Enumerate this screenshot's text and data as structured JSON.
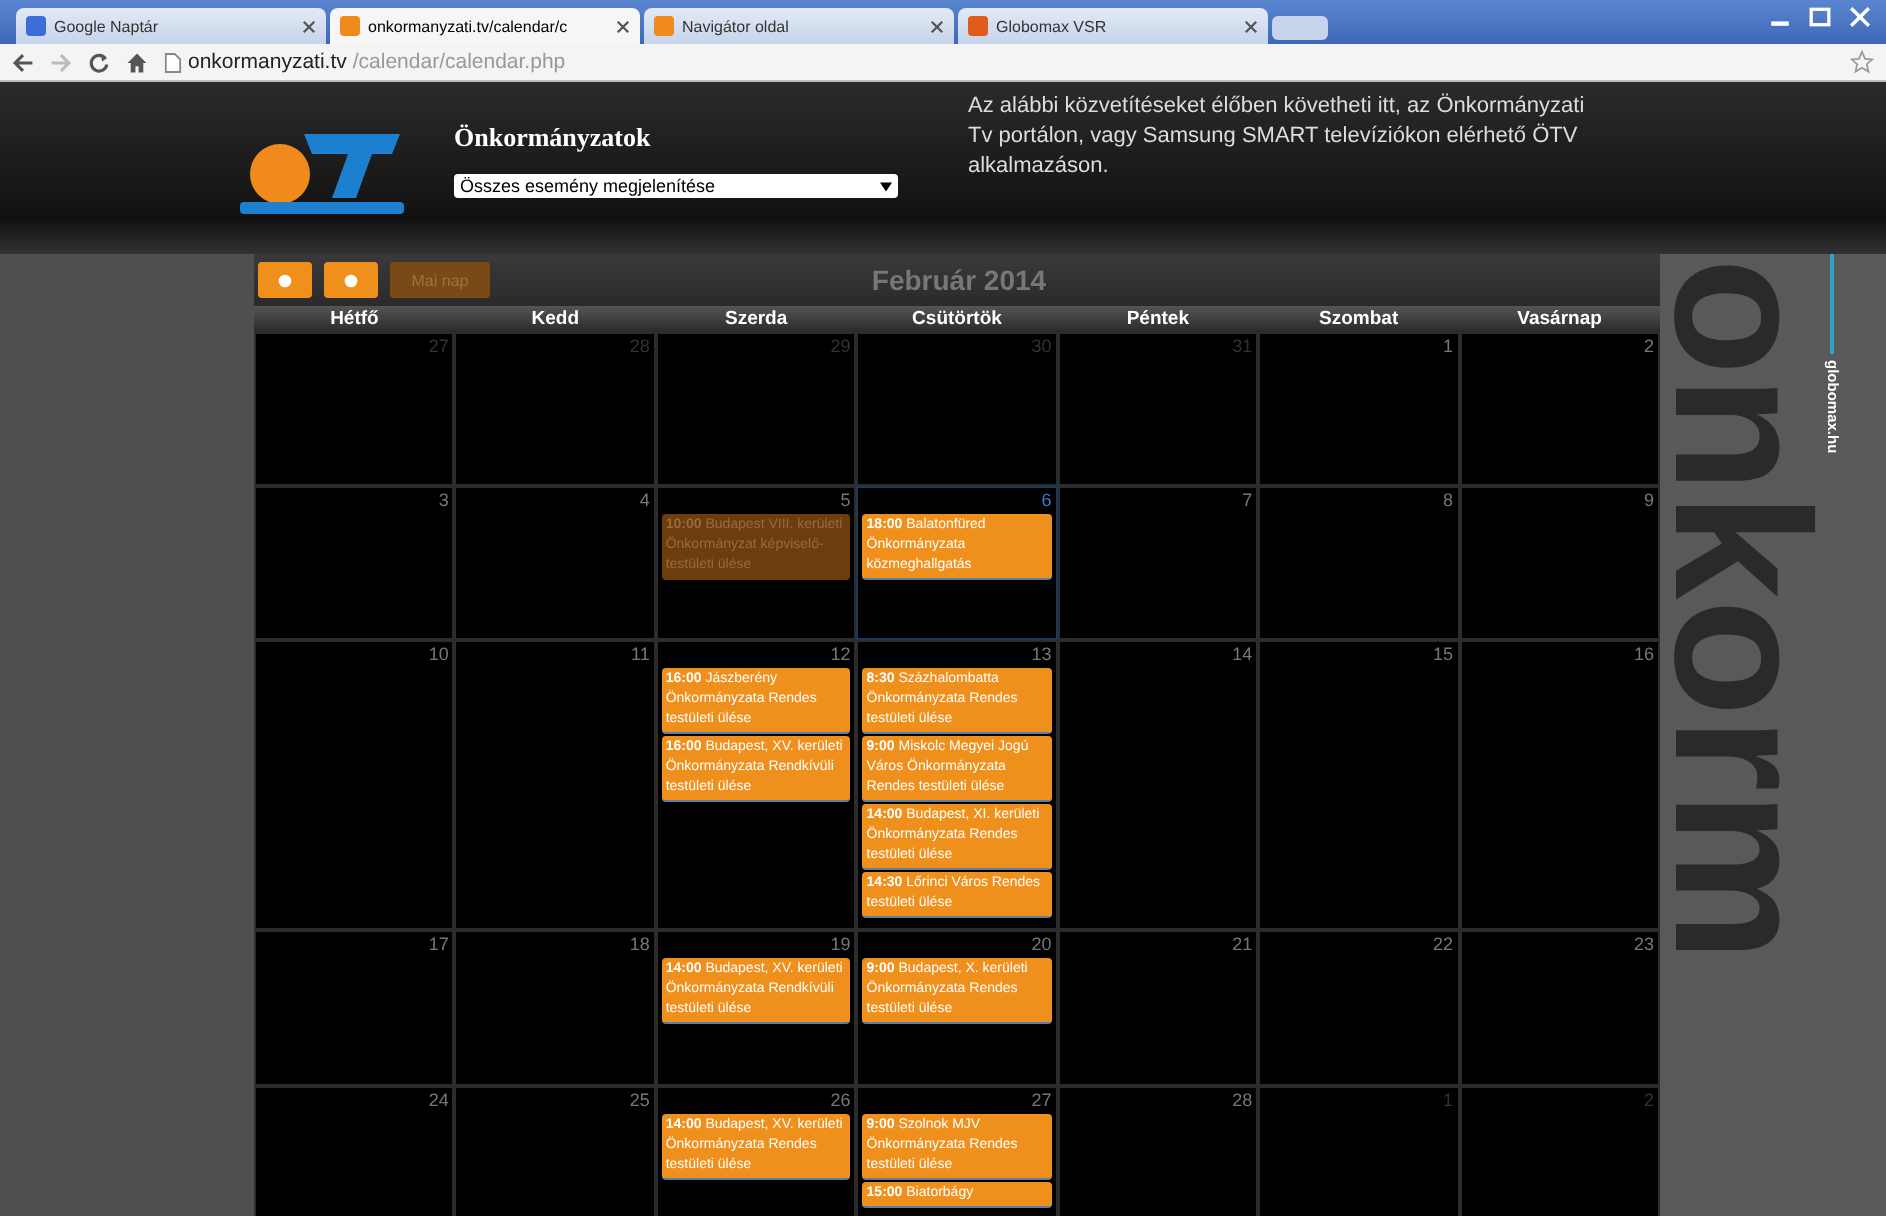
{
  "browser": {
    "tabs": [
      {
        "label": "Google Naptár",
        "selected": false,
        "color": "#3b6fd6"
      },
      {
        "label": "onkormanyzati.tv/calendar/c",
        "selected": true,
        "color": "#f08a1c"
      },
      {
        "label": "Navigátor oldal",
        "selected": false,
        "color": "#f08a1c"
      },
      {
        "label": "Globomax VSR",
        "selected": false,
        "color": "#e05a1a"
      }
    ],
    "address": {
      "host": "onkormanyzati.tv",
      "path": "/calendar/calendar.php"
    }
  },
  "header": {
    "title": "Önkormányzatok",
    "filter": "Összes esemény megjelenítése",
    "description": "Az alábbi közvetítéseket élőben követheti itt, az Önkormányzati Tv portálon, vagy Samsung SMART televíziókon elérhető ÖTV alkalmazáson."
  },
  "toolbar": {
    "today_button": {
      "label": "Mai nap",
      "disabled": true
    },
    "month": "Február 2014"
  },
  "weekdays": [
    "Hétfő",
    "Kedd",
    "Szerda",
    "Csütörtök",
    "Péntek",
    "Szombat",
    "Vasárnap"
  ],
  "weeks": [
    [
      {
        "day": "27",
        "other_month": true,
        "today": false
      },
      {
        "day": "28",
        "other_month": true,
        "today": false
      },
      {
        "day": "29",
        "other_month": true,
        "today": false
      },
      {
        "day": "30",
        "other_month": true,
        "today": false
      },
      {
        "day": "31",
        "other_month": true,
        "today": false
      },
      {
        "day": "1",
        "other_month": false,
        "today": false
      },
      {
        "day": "2",
        "other_month": false,
        "today": false
      }
    ],
    [
      {
        "day": "3",
        "other_month": false,
        "today": false
      },
      {
        "day": "4",
        "other_month": false,
        "today": false
      },
      {
        "day": "5",
        "other_month": false,
        "today": false,
        "events": [
          {
            "time": "10:00",
            "text": "Budapest VIII. kerületi Önkormányzat képviselő-testületi ülése",
            "past": true
          }
        ]
      },
      {
        "day": "6",
        "other_month": false,
        "today": true,
        "events": [
          {
            "time": "18:00",
            "text": "Balatonfüred Önkormányzata közmeghallgatás",
            "past": false
          }
        ]
      },
      {
        "day": "7",
        "other_month": false,
        "today": false
      },
      {
        "day": "8",
        "other_month": false,
        "today": false
      },
      {
        "day": "9",
        "other_month": false,
        "today": false
      }
    ],
    [
      {
        "day": "10",
        "other_month": false,
        "today": false
      },
      {
        "day": "11",
        "other_month": false,
        "today": false
      },
      {
        "day": "12",
        "other_month": false,
        "today": false,
        "events": [
          {
            "time": "16:00",
            "text": "Jászberény Önkormányzata Rendes testületi ülése",
            "past": false
          },
          {
            "time": "16:00",
            "text": "Budapest, XV. kerületi Önkormányzata Rendkívüli testületi ülése",
            "past": false
          }
        ]
      },
      {
        "day": "13",
        "other_month": false,
        "today": false,
        "events": [
          {
            "time": "8:30",
            "text": "Százhalombatta Önkormányzata Rendes testületi ülése",
            "past": false
          },
          {
            "time": "9:00",
            "text": "Miskolc Megyei Jogú Város Önkormányzata Rendes testületi ülése",
            "past": false
          },
          {
            "time": "14:00",
            "text": "Budapest, XI. kerületi Önkormányzata Rendes testületi ülése",
            "past": false
          },
          {
            "time": "14:30",
            "text": "Lőrinci Város Rendes testületi ülése",
            "past": false
          }
        ]
      },
      {
        "day": "14",
        "other_month": false,
        "today": false
      },
      {
        "day": "15",
        "other_month": false,
        "today": false
      },
      {
        "day": "16",
        "other_month": false,
        "today": false
      }
    ],
    [
      {
        "day": "17",
        "other_month": false,
        "today": false
      },
      {
        "day": "18",
        "other_month": false,
        "today": false
      },
      {
        "day": "19",
        "other_month": false,
        "today": false,
        "events": [
          {
            "time": "14:00",
            "text": "Budapest, XV. kerületi Önkormányzata Rendkívüli testületi ülése",
            "past": false
          }
        ]
      },
      {
        "day": "20",
        "other_month": false,
        "today": false,
        "events": [
          {
            "time": "9:00",
            "text": "Budapest, X. kerületi Önkormányzata Rendes testületi ülése",
            "past": false
          }
        ]
      },
      {
        "day": "21",
        "other_month": false,
        "today": false
      },
      {
        "day": "22",
        "other_month": false,
        "today": false
      },
      {
        "day": "23",
        "other_month": false,
        "today": false
      }
    ],
    [
      {
        "day": "24",
        "other_month": false,
        "today": false
      },
      {
        "day": "25",
        "other_month": false,
        "today": false
      },
      {
        "day": "26",
        "other_month": false,
        "today": false,
        "events": [
          {
            "time": "14:00",
            "text": "Budapest, XV. kerületi Önkormányzata Rendes testületi ülése",
            "past": false
          }
        ]
      },
      {
        "day": "27",
        "other_month": false,
        "today": false,
        "events": [
          {
            "time": "9:00",
            "text": "Szolnok MJV Önkormányzata Rendes testületi ülése",
            "past": false
          },
          {
            "time": "15:00",
            "text": "Biatorbágy",
            "past": false
          }
        ]
      },
      {
        "day": "28",
        "other_month": false,
        "today": false
      },
      {
        "day": "1",
        "other_month": true,
        "today": false
      },
      {
        "day": "2",
        "other_month": true,
        "today": false
      }
    ]
  ],
  "side_banner": {
    "word": "onkorm",
    "site": "globomax.hu"
  }
}
